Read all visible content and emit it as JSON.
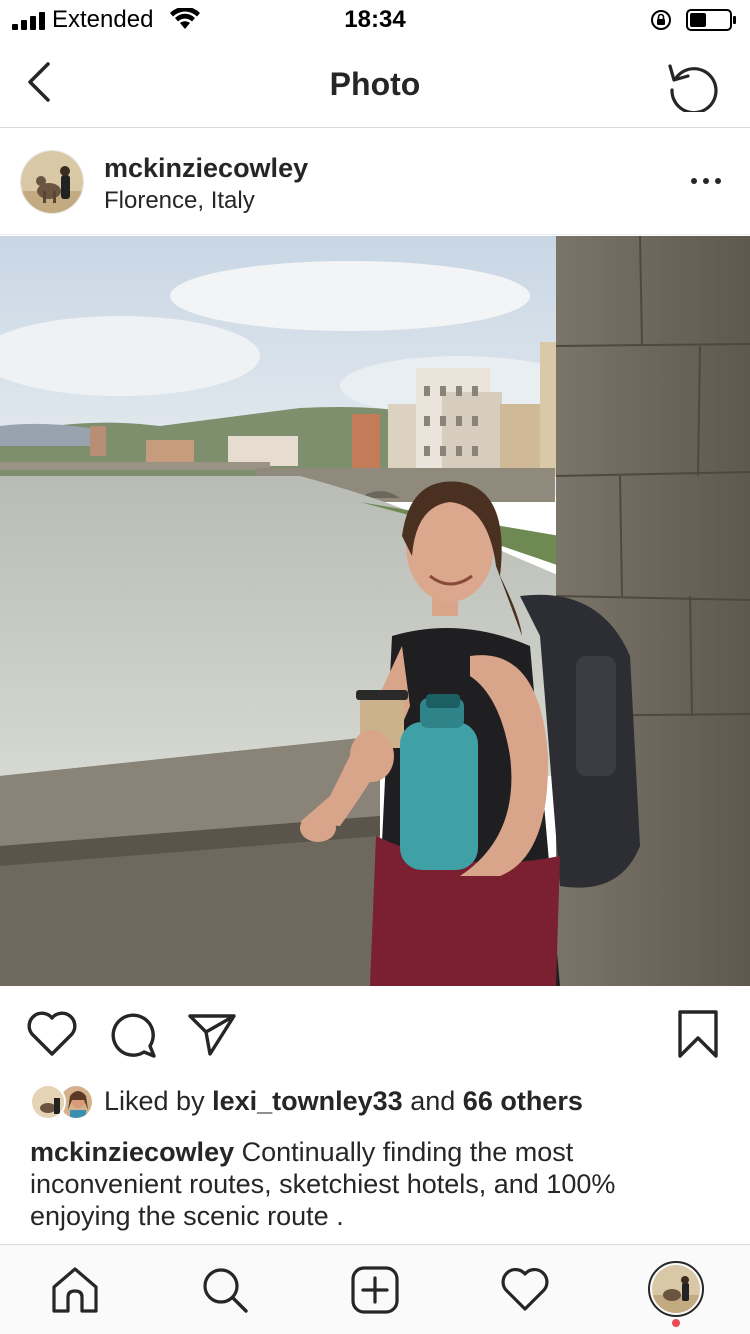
{
  "status_bar": {
    "carrier": "Extended",
    "time": "18:34"
  },
  "nav": {
    "title": "Photo"
  },
  "post": {
    "username": "mckinziecowley",
    "location": "Florence, Italy",
    "liked_by_prefix": "Liked by",
    "liked_by_user": "lexi_townley33",
    "liked_by_and": "and",
    "liked_by_others": "66 others",
    "caption_user": "mckinziecowley",
    "caption_text": "Continually finding the most inconvenient routes, sketchiest hotels, and 100% enjoying the scenic route ."
  },
  "icons": {
    "back": "chevron-left-icon",
    "refresh": "refresh-icon",
    "more": "more-horizontal-icon",
    "like": "heart-icon",
    "comment": "comment-icon",
    "share": "paper-plane-icon",
    "save": "bookmark-icon",
    "home": "home-icon",
    "search": "search-icon",
    "new_post": "plus-square-icon",
    "activity": "heart-icon"
  },
  "colors": {
    "notification_dot": "#ed4956",
    "text": "#262626",
    "divider": "#dbdbdb"
  }
}
